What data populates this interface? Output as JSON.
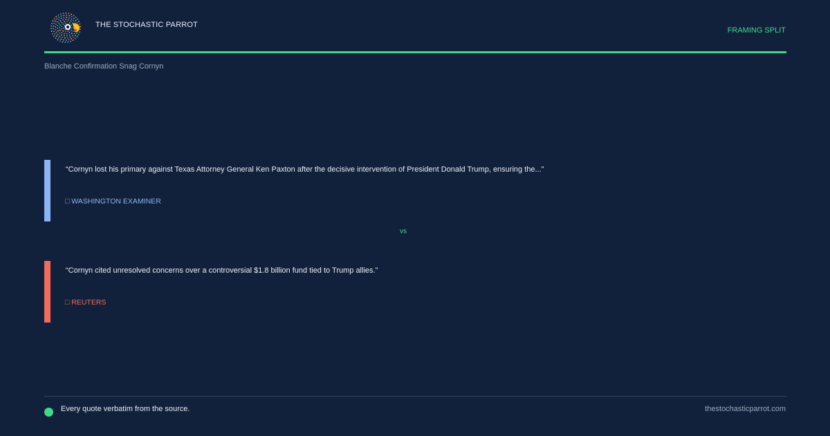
{
  "header": {
    "brand": "THE STOCHASTIC PARROT",
    "tag": "FRAMING SPLIT",
    "logo_icon": "parrot-logo-icon",
    "accent_color": "#3ddc84"
  },
  "headline": "Blanche Confirmation Snag Cornyn",
  "quotes": [
    {
      "text": "“Cornyn lost his primary against Texas Attorney General Ken Paxton after the decisive intervention of President Donald Trump, ensuring the...”",
      "source": "□ WASHINGTON EXAMINER",
      "color": "#8cb4f5"
    },
    {
      "text": "“Cornyn cited unresolved concerns over a controversial $1.8 billion fund tied to Trump allies.”",
      "source": "□ REUTERS",
      "color": "#f26b5b"
    }
  ],
  "divider_label": "vs",
  "footer": {
    "note": "Every quote verbatim from the source.",
    "site": "thestochasticparrot.com"
  }
}
